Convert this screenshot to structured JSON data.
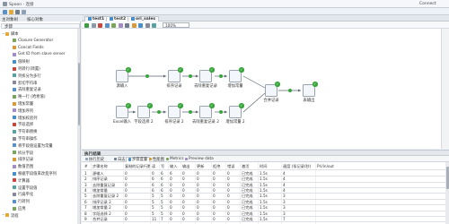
{
  "window": {
    "title": "Spoon - 连接",
    "connect_label": "Connect"
  },
  "toolbar": {
    "items": [
      "文件",
      "编辑",
      "视图",
      "执行",
      "工具",
      "帮助"
    ],
    "view_tabs": [
      "主对象树",
      "核心对象"
    ]
  },
  "sidebar": {
    "steps_label": "步骤",
    "rows": [
      {
        "label": "脚本",
        "folder": true
      },
      {
        "label": "Closure Generator"
      },
      {
        "label": "Concat Fields"
      },
      {
        "label": "Get ID from slave server"
      },
      {
        "label": "值映射"
      },
      {
        "label": "列转行(转置)"
      },
      {
        "label": "列拆分为多行"
      },
      {
        "label": "剪切字符串"
      },
      {
        "label": "去除重复记录"
      },
      {
        "label": "唯一行 (哈希值)"
      },
      {
        "label": "增加常量"
      },
      {
        "label": "增加序列"
      },
      {
        "label": "增加校验列"
      },
      {
        "label": "字段选择"
      },
      {
        "label": "字符串替换"
      },
      {
        "label": "字符串操作"
      },
      {
        "label": "将字段值设置为常量"
      },
      {
        "label": "拆分字段"
      },
      {
        "label": "排序记录"
      },
      {
        "label": "数值范围"
      },
      {
        "label": "根据字段值来改变序列"
      },
      {
        "label": "计算器"
      },
      {
        "label": "设置字段值"
      },
      {
        "label": "行扁平化"
      },
      {
        "label": "行转列"
      },
      {
        "label": "应用"
      },
      {
        "label": "流程",
        "folder": true
      }
    ]
  },
  "tabs": [
    {
      "label": "test1"
    },
    {
      "label": "test2"
    },
    {
      "label": "ori_sales"
    }
  ],
  "canvas": {
    "zoom": "100%"
  },
  "nodes": [
    {
      "label": "源输入"
    },
    {
      "label": "排序记录"
    },
    {
      "label": "去除重复记录"
    },
    {
      "label": "增加常量"
    },
    {
      "label": "Excel输入"
    },
    {
      "label": "字段选择 2"
    },
    {
      "label": "排序记录 2"
    },
    {
      "label": "去除重复记录 2"
    },
    {
      "label": "增加常量 2"
    },
    {
      "label": "合并记录"
    },
    {
      "label": "表输出"
    }
  ],
  "results": {
    "title": "执行结果",
    "tabs": [
      "执行历史",
      "日志",
      "步骤度量",
      "性能图",
      "Metrics",
      "Preview data"
    ],
    "columns": [
      "#",
      "步骤名称",
      "复制的记录行数",
      "读",
      "写",
      "输入",
      "输出",
      "更新",
      "拒绝",
      "错误",
      "激活",
      "时间",
      "速度 (条记录/秒)",
      "Pri/in/out"
    ],
    "rows": [
      [
        "1",
        "源输入",
        "0",
        "0",
        "6",
        "6",
        "0",
        "0",
        "0",
        "0",
        "已完成",
        "1.5s",
        "4",
        ""
      ],
      [
        "2",
        "排序记录",
        "0",
        "6",
        "6",
        "0",
        "0",
        "0",
        "0",
        "0",
        "已完成",
        "1.5s",
        "4",
        ""
      ],
      [
        "3",
        "去除重复记录",
        "0",
        "6",
        "6",
        "0",
        "0",
        "0",
        "0",
        "0",
        "已完成",
        "1.5s",
        "4",
        ""
      ],
      [
        "4",
        "增加常量",
        "0",
        "6",
        "6",
        "0",
        "0",
        "0",
        "0",
        "0",
        "已完成",
        "1.5s",
        "4",
        ""
      ],
      [
        "5",
        "去除重复记录 2",
        "0",
        "5",
        "5",
        "0",
        "0",
        "0",
        "0",
        "0",
        "已完成",
        "1.5s",
        "3",
        ""
      ],
      [
        "6",
        "排序记录 2",
        "0",
        "5",
        "5",
        "0",
        "0",
        "0",
        "0",
        "0",
        "已完成",
        "1.5s",
        "3",
        ""
      ],
      [
        "7",
        "增加常量 2",
        "0",
        "5",
        "5",
        "0",
        "0",
        "0",
        "0",
        "0",
        "已完成",
        "1.5s",
        "3",
        ""
      ],
      [
        "8",
        "字段选择 2",
        "0",
        "5",
        "5",
        "0",
        "0",
        "0",
        "0",
        "0",
        "已完成",
        "1.5s",
        "3",
        ""
      ],
      [
        "9",
        "合并记录",
        "0",
        "11",
        "7",
        "0",
        "0",
        "0",
        "0",
        "0",
        "已完成",
        "1.5s",
        "7",
        ""
      ]
    ]
  }
}
